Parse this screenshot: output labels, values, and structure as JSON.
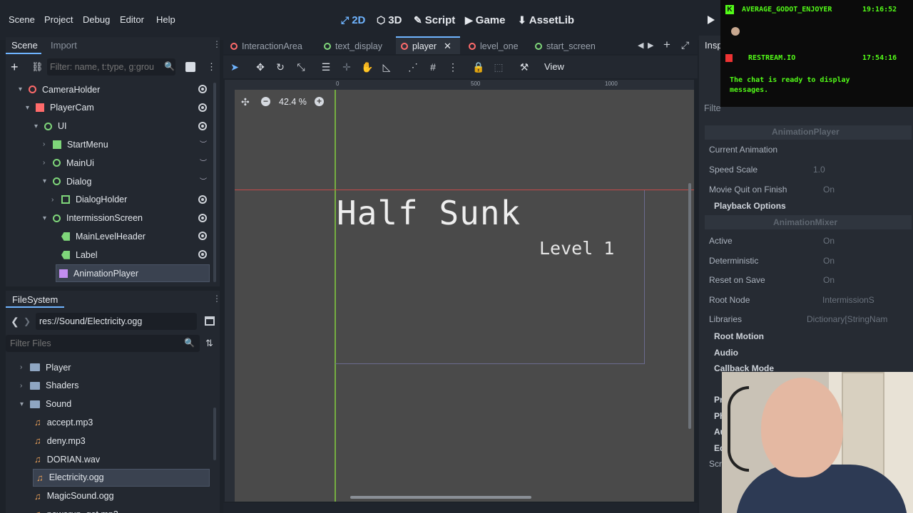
{
  "menubar": {
    "menus": [
      "Scene",
      "Project",
      "Debug",
      "Editor",
      "Help"
    ],
    "workspaces": [
      {
        "label": "2D",
        "icon": "2d-icon",
        "active": true
      },
      {
        "label": "3D",
        "icon": "3d-icon",
        "active": false
      },
      {
        "label": "Script",
        "icon": "script-icon",
        "active": false
      },
      {
        "label": "Game",
        "icon": "game-icon",
        "active": false
      },
      {
        "label": "AssetLib",
        "icon": "assetlib-icon",
        "active": false
      }
    ]
  },
  "scene_dock": {
    "tabs": [
      "Scene",
      "Import"
    ],
    "filter_placeholder": "Filter: name, t:type, g:grou",
    "nodes": [
      {
        "label": "CameraHolder",
        "icon": "node3d-icon",
        "color": "#ff6b6b"
      },
      {
        "label": "PlayerCam",
        "icon": "camera-icon",
        "color": "#ff6b6b"
      },
      {
        "label": "UI",
        "icon": "control-icon",
        "color": "#7fd67a"
      },
      {
        "label": "StartMenu",
        "icon": "panel-icon",
        "color": "#7fd67a"
      },
      {
        "label": "MainUi",
        "icon": "control-icon",
        "color": "#7fd67a"
      },
      {
        "label": "Dialog",
        "icon": "control-icon",
        "color": "#7fd67a"
      },
      {
        "label": "DialogHolder",
        "icon": "texture-icon",
        "color": "#7fd67a"
      },
      {
        "label": "IntermissionScreen",
        "icon": "control-icon",
        "color": "#7fd67a"
      },
      {
        "label": "MainLevelHeader",
        "icon": "label-icon",
        "color": "#7fd67a"
      },
      {
        "label": "Label",
        "icon": "label-icon",
        "color": "#7fd67a"
      },
      {
        "label": "AnimationPlayer",
        "icon": "animation-icon",
        "color": "#c38ef1"
      }
    ]
  },
  "filesystem": {
    "title": "FileSystem",
    "path": "res://Sound/Electricity.ogg",
    "filter_placeholder": "Filter Files",
    "items": [
      {
        "label": "Player",
        "type": "folder"
      },
      {
        "label": "Shaders",
        "type": "folder"
      },
      {
        "label": "Sound",
        "type": "folder"
      },
      {
        "label": "accept.mp3",
        "type": "audio"
      },
      {
        "label": "deny.mp3",
        "type": "audio"
      },
      {
        "label": "DORIAN.wav",
        "type": "audio"
      },
      {
        "label": "Electricity.ogg",
        "type": "audio"
      },
      {
        "label": "MagicSound.ogg",
        "type": "audio"
      },
      {
        "label": "powerup_get.mp3",
        "type": "audio"
      }
    ]
  },
  "editor": {
    "tabs": [
      {
        "label": "InteractionArea",
        "color": "#ff6b6b"
      },
      {
        "label": "text_display",
        "color": "#7fd67a"
      },
      {
        "label": "player",
        "color": "#ff6b6b"
      },
      {
        "label": "level_one",
        "color": "#ff6b6b"
      },
      {
        "label": "start_screen",
        "color": "#7fd67a"
      }
    ],
    "view_menu": "View",
    "zoom": "42.4 %",
    "ruler_marks": [
      "0",
      "500",
      "1000"
    ],
    "canvas_title": "Half Sunk",
    "canvas_subtitle": "Level 1"
  },
  "inspector": {
    "tab": "Insp",
    "filter": "Filte",
    "header": "AnimationPlayer",
    "rows": [
      {
        "label": "Current Animation",
        "value": ""
      },
      {
        "label": "Speed Scale",
        "value": "1.0"
      },
      {
        "label": "Movie Quit on Finish",
        "value": "On"
      }
    ],
    "section1": "Playback Options",
    "header2": "AnimationMixer",
    "rows2": [
      {
        "label": "Active",
        "value": "On"
      },
      {
        "label": "Deterministic",
        "value": "On"
      },
      {
        "label": "Reset on Save",
        "value": "On"
      },
      {
        "label": "Root Node",
        "value": "IntermissionS"
      },
      {
        "label": "Libraries",
        "value": "Dictionary[StringNam"
      }
    ],
    "sections": [
      "Root Motion",
      "Audio",
      "Callback Mode"
    ],
    "partial": [
      "Pr",
      "Ph",
      "Au",
      "Ed",
      "Scri"
    ]
  },
  "chat": {
    "user": "AVERAGE_GODOT_ENJOYER",
    "user_time": "19:16:52",
    "service": "RESTREAM.IO",
    "service_time": "17:54:16",
    "message": "The chat is ready to display messages."
  }
}
